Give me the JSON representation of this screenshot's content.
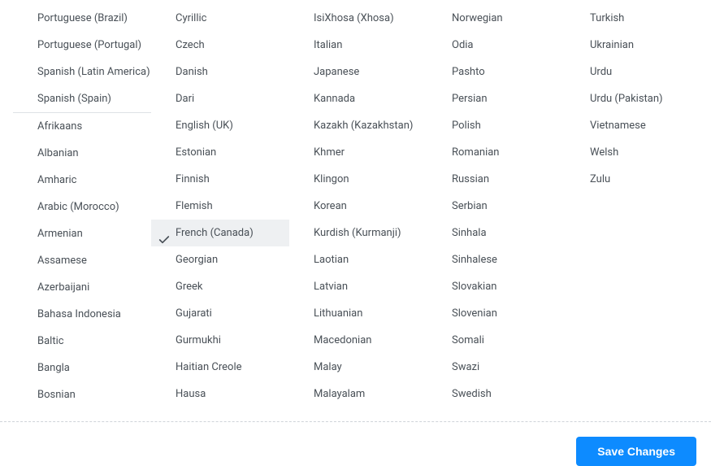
{
  "columns": [
    {
      "items": [
        {
          "label": "Portuguese (Brazil)",
          "name": "lang-portuguese-brazil"
        },
        {
          "label": "Portuguese (Portugal)",
          "name": "lang-portuguese-portugal"
        },
        {
          "label": "Spanish (Latin America)",
          "name": "lang-spanish-latin-america"
        },
        {
          "label": "Spanish (Spain)",
          "name": "lang-spanish-spain"
        }
      ],
      "divider_after": 3,
      "items2": [
        {
          "label": "Afrikaans",
          "name": "lang-afrikaans"
        },
        {
          "label": "Albanian",
          "name": "lang-albanian"
        },
        {
          "label": "Amharic",
          "name": "lang-amharic"
        },
        {
          "label": "Arabic (Morocco)",
          "name": "lang-arabic-morocco"
        },
        {
          "label": "Armenian",
          "name": "lang-armenian"
        },
        {
          "label": "Assamese",
          "name": "lang-assamese"
        },
        {
          "label": "Azerbaijani",
          "name": "lang-azerbaijani"
        },
        {
          "label": "Bahasa Indonesia",
          "name": "lang-bahasa-indonesia"
        },
        {
          "label": "Baltic",
          "name": "lang-baltic"
        },
        {
          "label": "Bangla",
          "name": "lang-bangla"
        },
        {
          "label": "Bosnian",
          "name": "lang-bosnian"
        }
      ]
    },
    {
      "items": [
        {
          "label": "Cyrillic",
          "name": "lang-cyrillic"
        },
        {
          "label": "Czech",
          "name": "lang-czech"
        },
        {
          "label": "Danish",
          "name": "lang-danish"
        },
        {
          "label": "Dari",
          "name": "lang-dari"
        },
        {
          "label": "English (UK)",
          "name": "lang-english-uk"
        },
        {
          "label": "Estonian",
          "name": "lang-estonian"
        },
        {
          "label": "Finnish",
          "name": "lang-finnish"
        },
        {
          "label": "Flemish",
          "name": "lang-flemish"
        },
        {
          "label": "French (Canada)",
          "name": "lang-french-canada",
          "hovered": true,
          "checked": true
        },
        {
          "label": "Georgian",
          "name": "lang-georgian"
        },
        {
          "label": "Greek",
          "name": "lang-greek"
        },
        {
          "label": "Gujarati",
          "name": "lang-gujarati"
        },
        {
          "label": "Gurmukhi",
          "name": "lang-gurmukhi"
        },
        {
          "label": "Haitian Creole",
          "name": "lang-haitian-creole"
        },
        {
          "label": "Hausa",
          "name": "lang-hausa"
        }
      ]
    },
    {
      "items": [
        {
          "label": "IsiXhosa (Xhosa)",
          "name": "lang-isixhosa"
        },
        {
          "label": "Italian",
          "name": "lang-italian"
        },
        {
          "label": "Japanese",
          "name": "lang-japanese"
        },
        {
          "label": "Kannada",
          "name": "lang-kannada"
        },
        {
          "label": "Kazakh (Kazakhstan)",
          "name": "lang-kazakh"
        },
        {
          "label": "Khmer",
          "name": "lang-khmer"
        },
        {
          "label": "Klingon",
          "name": "lang-klingon"
        },
        {
          "label": "Korean",
          "name": "lang-korean"
        },
        {
          "label": "Kurdish (Kurmanji)",
          "name": "lang-kurdish-kurmanji"
        },
        {
          "label": "Laotian",
          "name": "lang-laotian"
        },
        {
          "label": "Latvian",
          "name": "lang-latvian"
        },
        {
          "label": "Lithuanian",
          "name": "lang-lithuanian"
        },
        {
          "label": "Macedonian",
          "name": "lang-macedonian"
        },
        {
          "label": "Malay",
          "name": "lang-malay"
        },
        {
          "label": "Malayalam",
          "name": "lang-malayalam"
        }
      ]
    },
    {
      "items": [
        {
          "label": "Norwegian",
          "name": "lang-norwegian"
        },
        {
          "label": "Odia",
          "name": "lang-odia"
        },
        {
          "label": "Pashto",
          "name": "lang-pashto"
        },
        {
          "label": "Persian",
          "name": "lang-persian"
        },
        {
          "label": "Polish",
          "name": "lang-polish"
        },
        {
          "label": "Romanian",
          "name": "lang-romanian"
        },
        {
          "label": "Russian",
          "name": "lang-russian"
        },
        {
          "label": "Serbian",
          "name": "lang-serbian"
        },
        {
          "label": "Sinhala",
          "name": "lang-sinhala"
        },
        {
          "label": "Sinhalese",
          "name": "lang-sinhalese"
        },
        {
          "label": "Slovakian",
          "name": "lang-slovakian"
        },
        {
          "label": "Slovenian",
          "name": "lang-slovenian"
        },
        {
          "label": "Somali",
          "name": "lang-somali"
        },
        {
          "label": "Swazi",
          "name": "lang-swazi"
        },
        {
          "label": "Swedish",
          "name": "lang-swedish"
        }
      ]
    },
    {
      "items": [
        {
          "label": "Turkish",
          "name": "lang-turkish"
        },
        {
          "label": "Ukrainian",
          "name": "lang-ukrainian"
        },
        {
          "label": "Urdu",
          "name": "lang-urdu"
        },
        {
          "label": "Urdu (Pakistan)",
          "name": "lang-urdu-pakistan"
        },
        {
          "label": "Vietnamese",
          "name": "lang-vietnamese"
        },
        {
          "label": "Welsh",
          "name": "lang-welsh"
        },
        {
          "label": "Zulu",
          "name": "lang-zulu"
        }
      ]
    }
  ],
  "footer": {
    "save_label": "Save Changes"
  }
}
